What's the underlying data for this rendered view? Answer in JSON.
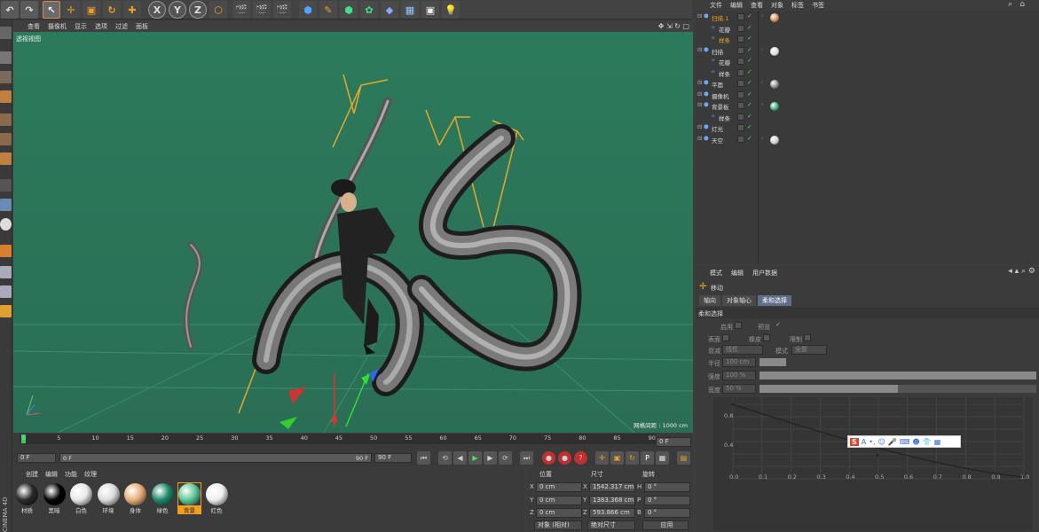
{
  "toolbar": {
    "axis_x": "X",
    "axis_y": "Y",
    "axis_z": "Z"
  },
  "viewport": {
    "menu": [
      "查看",
      "摄像机",
      "显示",
      "选项",
      "过滤",
      "面板"
    ],
    "label": "透视视图",
    "grid_info": "网格间距 : 1000 cm",
    "nav_icons": "✥ ⇲ ↻ ▢"
  },
  "timeline": {
    "ticks": [
      "0",
      "5",
      "10",
      "15",
      "20",
      "25",
      "30",
      "35",
      "40",
      "45",
      "50",
      "55",
      "60",
      "65",
      "70",
      "75",
      "80",
      "85",
      "90"
    ],
    "frame_end_field": "0 F"
  },
  "playback": {
    "current_frame": "0 F",
    "range_start": "0 F",
    "range_end": "90 F",
    "field_end": "90 F"
  },
  "material_manager": {
    "menu": [
      "创建",
      "编辑",
      "功能",
      "纹理"
    ],
    "brand": "CINEMA 4D",
    "materials": [
      {
        "name": "材质",
        "color": "#2a2a2a"
      },
      {
        "name": "黑暗",
        "color": "#050505"
      },
      {
        "name": "白色",
        "color": "#e8e8e8"
      },
      {
        "name": "环境",
        "color": "#dcdcdc"
      },
      {
        "name": "身体",
        "color": "#e7b07a"
      },
      {
        "name": "绿色",
        "color": "#1f8a6b"
      },
      {
        "name": "背景",
        "color": "#5ec99a",
        "selected": true
      },
      {
        "name": "红色",
        "color": "#efefef"
      }
    ]
  },
  "coordinates": {
    "headers": [
      "位置",
      "尺寸",
      "旋转"
    ],
    "rows": [
      {
        "axis": "X",
        "pos": "0 cm",
        "size_axis": "X",
        "size": "1542.317 cm",
        "rot_axis": "H",
        "rot": "0 °"
      },
      {
        "axis": "Y",
        "pos": "0 cm",
        "size_axis": "Y",
        "size": "1383.368 cm",
        "rot_axis": "P",
        "rot": "0 °"
      },
      {
        "axis": "Z",
        "pos": "0 cm",
        "size_axis": "Z",
        "size": "593.866 cm",
        "rot_axis": "B",
        "rot": "0 °"
      }
    ],
    "mode_left": "对象 (相对)",
    "mode_right": "绝对尺寸",
    "apply": "应用"
  },
  "object_manager": {
    "menu": [
      "文件",
      "编辑",
      "查看",
      "对象",
      "标签",
      "书签"
    ],
    "objects": [
      {
        "name": "扫描.1",
        "indent": 0,
        "highlight": true,
        "tag": "#d88a55"
      },
      {
        "name": "花瓣",
        "indent": 1
      },
      {
        "name": "样条",
        "indent": 1,
        "highlight": true
      },
      {
        "name": "扫描",
        "indent": 0,
        "tag": "#dddddd"
      },
      {
        "name": "花瓣",
        "indent": 1
      },
      {
        "name": "样条",
        "indent": 1
      },
      {
        "name": "平面",
        "indent": 0,
        "tag": "#888888"
      },
      {
        "name": "摄像机",
        "indent": 0
      },
      {
        "name": "背景板",
        "indent": 0,
        "tag": "#3aa87a"
      },
      {
        "name": "样条",
        "indent": 1
      },
      {
        "name": "灯光",
        "indent": 0
      },
      {
        "name": "天空",
        "indent": 0,
        "tag": "#cccccc"
      }
    ]
  },
  "attributes": {
    "menu": [
      "模式",
      "编辑",
      "用户数据"
    ],
    "tool_name": "移动",
    "tabs": [
      "轴向",
      "对象轴心",
      "柔和选择"
    ],
    "active_tab": "柔和选择",
    "section": "柔和选择",
    "enable_label": "启用",
    "preview_label": "预览",
    "surface_label": "表面",
    "rubber_label": "橡皮",
    "restrict_label": "限制",
    "falloff_label": "衰减",
    "falloff_value": "线性",
    "mode_label": "模式",
    "mode_value": "全部",
    "radius_label": "半径",
    "radius_value": "100 cm",
    "strength_label": "强度",
    "strength_value": "100 %",
    "strength_fill": 1.0,
    "width_label": "宽度",
    "width_value": "50 %",
    "width_fill": 0.5,
    "graph_y": [
      "0.8",
      "0.4"
    ],
    "graph_x": [
      "0.0",
      "0.1",
      "0.2",
      "0.3",
      "0.4",
      "0.5",
      "0.6",
      "0.7",
      "0.8",
      "0.9",
      "1.0"
    ]
  }
}
